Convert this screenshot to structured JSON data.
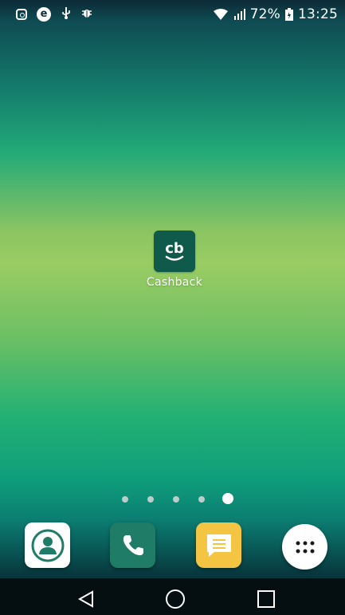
{
  "statusbar": {
    "left_icons": [
      "instagram-icon",
      "e-icon",
      "usb-icon",
      "bug-icon"
    ],
    "battery": "72%",
    "time": "13:25",
    "e_letter": "e"
  },
  "home": {
    "app": {
      "label": "Cashback",
      "logo_text": "cb",
      "icon": "cashback-icon",
      "color": "#0f5a4a"
    },
    "page_indicator": {
      "count": 5,
      "active_index": 4
    }
  },
  "dock": {
    "items": [
      {
        "name": "contacts",
        "icon": "contacts-icon"
      },
      {
        "name": "phone",
        "icon": "phone-icon"
      },
      {
        "name": "messages",
        "icon": "messages-icon"
      },
      {
        "name": "apps",
        "icon": "app-drawer-icon"
      }
    ]
  },
  "navbar": {
    "buttons": [
      "back-icon",
      "home-icon",
      "recents-icon"
    ]
  }
}
